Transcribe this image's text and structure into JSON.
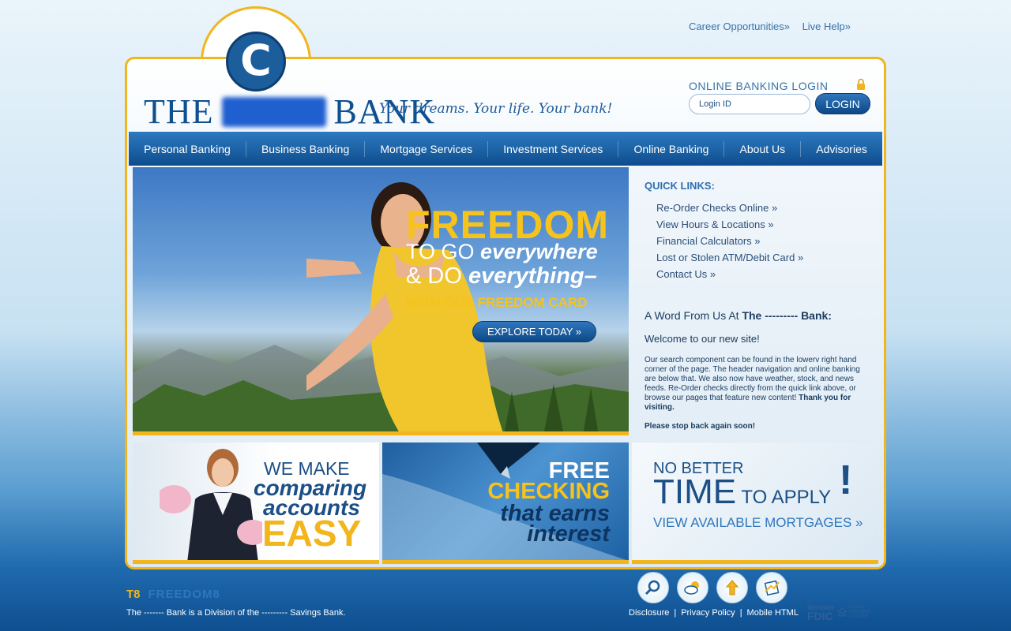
{
  "utility": {
    "career": "Career Opportunities»",
    "help": "Live Help»"
  },
  "brand": {
    "logo_letter": "C",
    "the": "THE",
    "bank": "BANK",
    "tagline": "Your dreams. Your life. Your bank!"
  },
  "login": {
    "label": "ONLINE BANKING LOGIN",
    "placeholder": "Login ID",
    "button": "LOGIN"
  },
  "nav": [
    "Personal Banking",
    "Business Banking",
    "Mortgage Services",
    "Investment Services",
    "Online Banking",
    "About Us",
    "Advisories"
  ],
  "hero": {
    "headline": "FREEDOM",
    "line2_plain": "TO GO ",
    "line2_em": "everywhere",
    "line3_plain": "& DO ",
    "line3_em": "everything–",
    "line4": "WITH OUR FREEDOM CARD",
    "button": "EXPLORE TODAY »"
  },
  "quick_links": {
    "title": "QUICK LINKS:",
    "items": [
      "Re-Order Checks Online »",
      "View Hours & Locations »",
      "Financial Calculators »",
      "Lost or Stolen ATM/Debit Card »",
      "Contact Us »"
    ]
  },
  "word": {
    "title_plain": "A Word From Us At ",
    "title_bold": "The --------- Bank:",
    "welcome": "Welcome to our new site!",
    "body": "Our search component can be found in the lowerv right hand corner of the page. The header navigation and online banking are below that.  We also now have weather, stock, and news feeds. Re-Order checks directly from the quick link above, or browse our pages that feature new content! ",
    "body_bold": "Thank you for visiting.",
    "closing": "Please stop back again soon!"
  },
  "promos": {
    "p1": [
      "WE MAKE",
      "comparing",
      "accounts",
      "EASY"
    ],
    "p2": [
      "FREE",
      "CHECKING",
      "that earns",
      "interest"
    ],
    "p3": {
      "line1": "NO BETTER",
      "time": "TIME",
      "to_apply": " TO APPLY",
      "bang": "!",
      "cta": "VIEW AVAILABLE MORTGAGES »"
    }
  },
  "footer": {
    "logo1": "T8",
    "logo2": "FREEDOM8",
    "division": "The ------- Bank is a Division of the --------- Savings Bank.",
    "links": [
      "Disclosure",
      "Privacy Policy",
      "Mobile HTML"
    ],
    "separator": "|",
    "fdic_top": "Member",
    "fdic_big": "FDIC",
    "eho": "EQUAL HOUSING LENDER",
    "icons": [
      "search-icon",
      "weather-icon",
      "stock-icon",
      "news-icon"
    ]
  },
  "colors": {
    "brand_blue": "#0e4f8f",
    "accent_gold": "#f2b51c",
    "nav_blue": "#1a5fa3"
  }
}
